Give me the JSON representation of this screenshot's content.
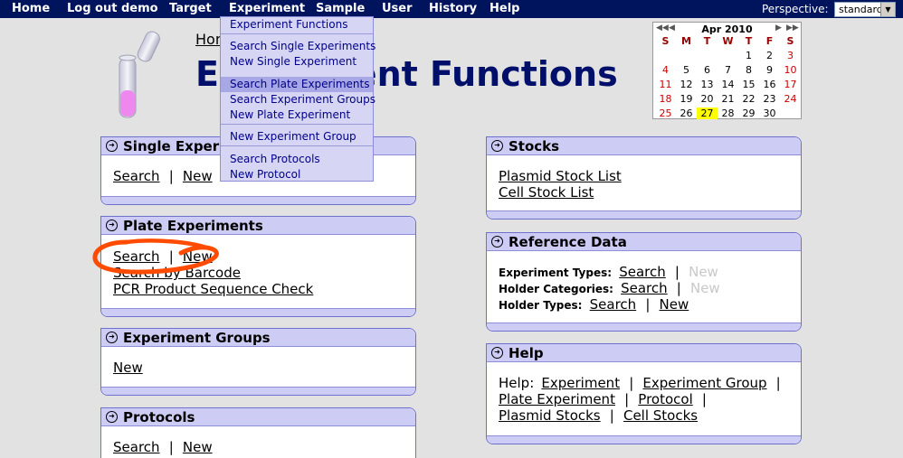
{
  "nav": {
    "items": [
      "Home",
      "Log out demo",
      "Target",
      "Experiment",
      "Sample",
      "User",
      "History",
      "Help"
    ],
    "perspective_label": "Perspective:",
    "perspective_value": "standard"
  },
  "dropdown": {
    "items": [
      "Experiment Functions",
      "Search Single Experiments",
      "New Single Experiment",
      "Search Plate Experiments",
      "Search Experiment Groups",
      "New Plate Experiment",
      "New Experiment Group",
      "Search Protocols",
      "New Protocol"
    ]
  },
  "header": {
    "home_link": "Home",
    "title": "Experiment Functions"
  },
  "calendar": {
    "month": "Apr 2010",
    "dow": [
      "S",
      "M",
      "T",
      "W",
      "T",
      "F",
      "S"
    ],
    "weeks": [
      [
        "",
        "",
        "",
        "",
        "1",
        "2",
        "3"
      ],
      [
        "4",
        "5",
        "6",
        "7",
        "8",
        "9",
        "10"
      ],
      [
        "11",
        "12",
        "13",
        "14",
        "15",
        "16",
        "17"
      ],
      [
        "18",
        "19",
        "20",
        "21",
        "22",
        "23",
        "24"
      ],
      [
        "25",
        "26",
        "27",
        "28",
        "29",
        "30",
        ""
      ]
    ],
    "today": "27"
  },
  "panels": {
    "single": {
      "title": "Single Experiments",
      "search": "Search",
      "new": "New",
      "sep": "|"
    },
    "plate": {
      "title": "Plate Experiments",
      "search": "Search",
      "new": "New",
      "sep": "|",
      "barcode": "Search by Barcode",
      "pcr": "PCR Product Sequence Check"
    },
    "groups": {
      "title": "Experiment Groups",
      "new": "New"
    },
    "protocols": {
      "title": "Protocols",
      "search": "Search",
      "new": "New",
      "sep": "|"
    },
    "stocks": {
      "title": "Stocks",
      "plasmid": "Plasmid Stock List",
      "cell": "Cell Stock List"
    },
    "reference": {
      "title": "Reference Data",
      "rows": [
        {
          "label": "Experiment Types:",
          "search": "Search",
          "new": "New"
        },
        {
          "label": "Holder Categories:",
          "search": "Search",
          "new": "New"
        },
        {
          "label": "Holder Types:",
          "search": "Search",
          "new": "New"
        }
      ],
      "sep": "|"
    },
    "help": {
      "title": "Help",
      "label": "Help:",
      "links": [
        "Experiment",
        "Experiment Group",
        "Plate Experiment",
        "Protocol",
        "Plasmid Stocks",
        "Cell Stocks"
      ],
      "sep": "|"
    }
  },
  "colors": {
    "nav_bg": "#00145e",
    "title": "#00106a",
    "panel_head": "#ccccf4",
    "dropdown_bg": "#d6d6f4",
    "annotation": "#ff4b00",
    "today": "#ffff00"
  }
}
